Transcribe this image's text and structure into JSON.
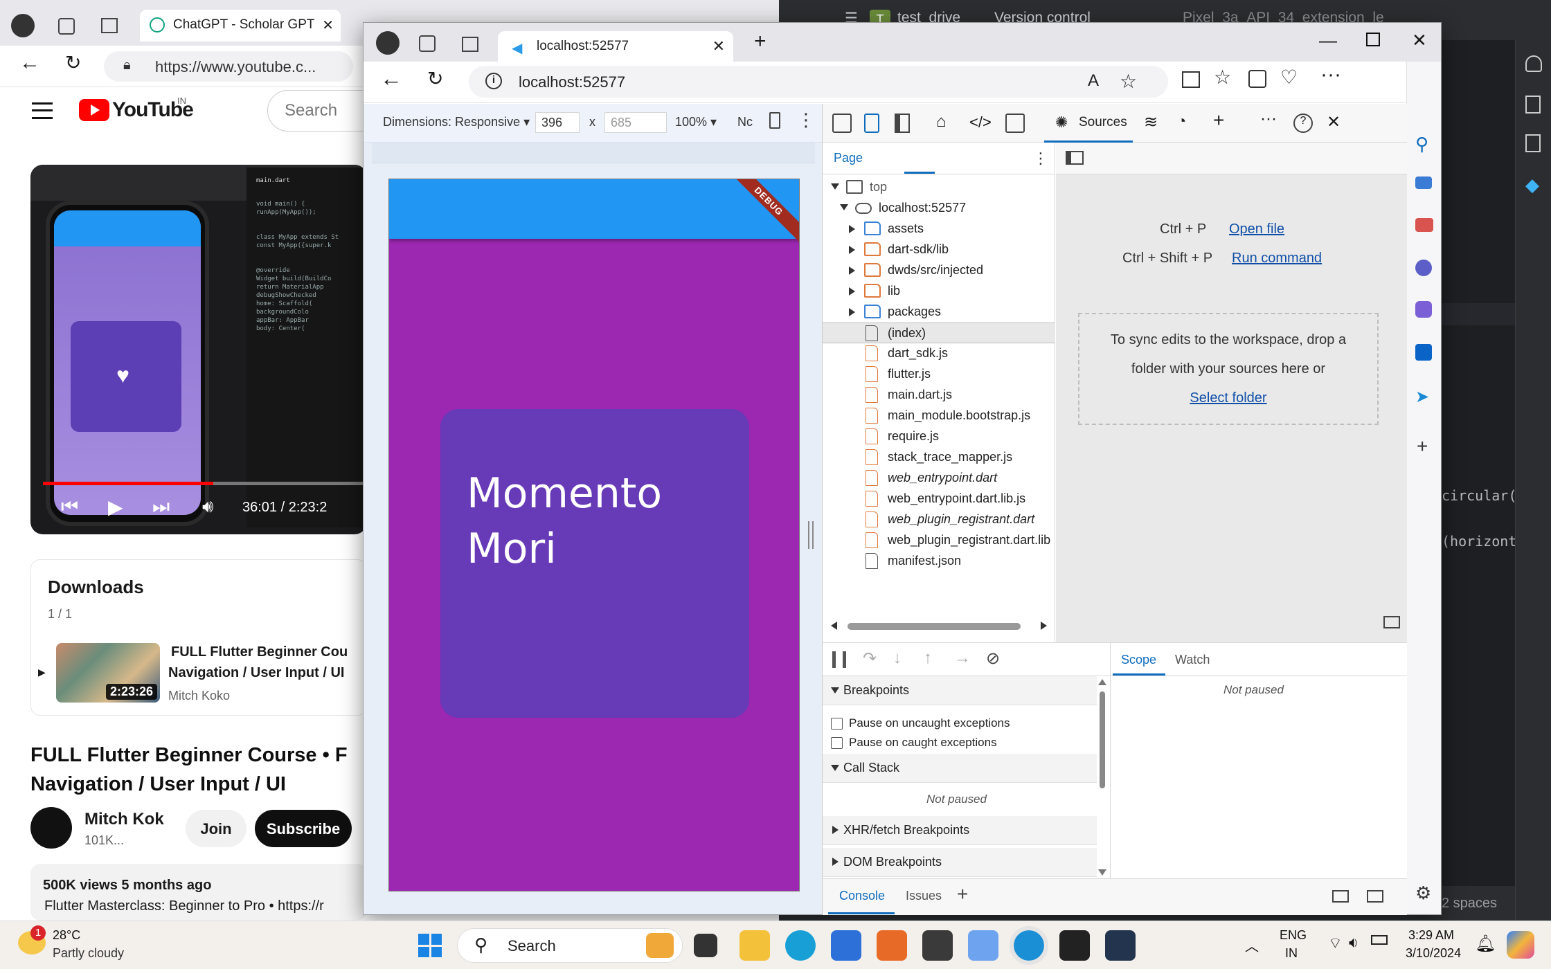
{
  "ide": {
    "project": "test_drive",
    "vcs": "Version control",
    "device": "Pixel_3a_API_34_extension_le",
    "code_a": "circular(",
    "code_b": "(horizont",
    "status_spaces": "2 spaces"
  },
  "bg_browser": {
    "tab_label": "ChatGPT - Scholar GPT",
    "url": "https://www.youtube.c...",
    "youtube": {
      "logo_text": "YouTube",
      "region": "IN",
      "search_placeholder": "Search",
      "video_time": "36:01 / 2:23:2",
      "downloads_title": "Downloads",
      "downloads_count": "1 / 1",
      "dl_duration": "2:23:26",
      "dl_title_1": "FULL Flutter Beginner Cou",
      "dl_title_2": "Navigation / User Input / UI",
      "dl_channel": "Mitch Koko",
      "title_1": "FULL Flutter Beginner Course • F",
      "title_2": "Navigation / User Input / UI",
      "channel": "Mitch Kok",
      "subs": "101K...",
      "join": "Join",
      "subscribe": "Subscribe",
      "views": "500K views  5 months ago",
      "desc_line": "Flutter Masterclass: Beginner to Pro • https://r"
    }
  },
  "edge": {
    "tab_title": "localhost:52577",
    "address": "localhost:52577",
    "emulation": {
      "dimensions": "Dimensions: Responsive",
      "width": "396",
      "height": "685",
      "times": "x",
      "zoom": "100%",
      "throttle": "Nc"
    },
    "app": {
      "debug": "DEBUG",
      "card_text": "Momento Mori"
    }
  },
  "devtools": {
    "sources_label": "Sources",
    "page_tab": "Page",
    "tree": [
      {
        "label": "top",
        "depth": 0,
        "kind": "frame",
        "arrow": "down"
      },
      {
        "label": "localhost:52577",
        "depth": 1,
        "kind": "cloud",
        "arrow": "down"
      },
      {
        "label": "assets",
        "depth": 2,
        "kind": "folder-blue",
        "arrow": "right"
      },
      {
        "label": "dart-sdk/lib",
        "depth": 2,
        "kind": "folder-orange",
        "arrow": "right"
      },
      {
        "label": "dwds/src/injected",
        "depth": 2,
        "kind": "folder-orange",
        "arrow": "right"
      },
      {
        "label": "lib",
        "depth": 2,
        "kind": "folder-orange",
        "arrow": "right"
      },
      {
        "label": "packages",
        "depth": 2,
        "kind": "folder-blue",
        "arrow": "right"
      },
      {
        "label": "(index)",
        "depth": 2,
        "kind": "file-gray",
        "arrow": "",
        "selected": true
      },
      {
        "label": "dart_sdk.js",
        "depth": 2,
        "kind": "file-orange",
        "arrow": ""
      },
      {
        "label": "flutter.js",
        "depth": 2,
        "kind": "file-orange",
        "arrow": ""
      },
      {
        "label": "main.dart.js",
        "depth": 2,
        "kind": "file-orange",
        "arrow": ""
      },
      {
        "label": "main_module.bootstrap.js",
        "depth": 2,
        "kind": "file-orange",
        "arrow": ""
      },
      {
        "label": "require.js",
        "depth": 2,
        "kind": "file-orange",
        "arrow": ""
      },
      {
        "label": "stack_trace_mapper.js",
        "depth": 2,
        "kind": "file-orange",
        "arrow": ""
      },
      {
        "label": "web_entrypoint.dart",
        "depth": 2,
        "kind": "file-orange",
        "arrow": "",
        "italic": true
      },
      {
        "label": "web_entrypoint.dart.lib.js",
        "depth": 2,
        "kind": "file-orange",
        "arrow": ""
      },
      {
        "label": "web_plugin_registrant.dart",
        "depth": 2,
        "kind": "file-orange",
        "arrow": "",
        "italic": true
      },
      {
        "label": "web_plugin_registrant.dart.lib",
        "depth": 2,
        "kind": "file-orange",
        "arrow": ""
      },
      {
        "label": "manifest.json",
        "depth": 2,
        "kind": "file-gray",
        "arrow": ""
      }
    ],
    "editor": {
      "open_file_keys": "Ctrl + P",
      "open_file": "Open file",
      "run_cmd_keys": "Ctrl + Shift + P",
      "run_cmd": "Run command",
      "drop_text_1": "To sync edits to the workspace, drop a",
      "drop_text_2": "folder with your sources here or",
      "select_folder": "Select folder"
    },
    "debugger": {
      "breakpoints": "Breakpoints",
      "pause_uncaught": "Pause on uncaught exceptions",
      "pause_caught": "Pause on caught exceptions",
      "call_stack": "Call Stack",
      "not_paused": "Not paused",
      "xhr": "XHR/fetch Breakpoints",
      "dom": "DOM Breakpoints",
      "scope": "Scope",
      "watch": "Watch",
      "scope_not_paused": "Not paused"
    },
    "drawer": {
      "console": "Console",
      "issues": "Issues"
    }
  },
  "taskbar": {
    "weather_temp": "28°C",
    "weather_desc": "Partly cloudy",
    "weather_badge": "1",
    "search": "Search",
    "lang_1": "ENG",
    "lang_2": "IN",
    "time": "3:29 AM",
    "date": "3/10/2024"
  },
  "colors": {
    "flutter_purple": "#9c27b0",
    "flutter_deep_purple": "#673ab7",
    "flutter_blue": "#2196f3",
    "edge_accent": "#0f6cbd"
  }
}
